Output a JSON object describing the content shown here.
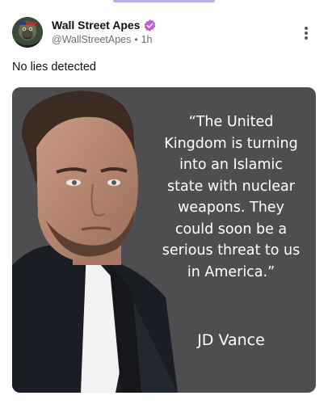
{
  "post": {
    "author": {
      "display_name": "Wall Street Apes",
      "handle": "@WallStreetApes",
      "time": "1h",
      "separator": "•",
      "avatar_icon": "gorilla-avatar",
      "verified_icon": "verified-badge-icon",
      "verified_color": "#c15bd6"
    },
    "more_icon": "more-vertical-icon",
    "text": "No lies detected",
    "image": {
      "quote": "“The United Kingdom is turning into an Islamic state with nuclear weapons. They could soon be a serious threat to us in America.”",
      "attribution": "JD Vance",
      "background_color": "#4e4e50"
    }
  },
  "colors": {
    "tab_indicator": "#b9b1e6",
    "meta_text": "#6b6b72"
  }
}
